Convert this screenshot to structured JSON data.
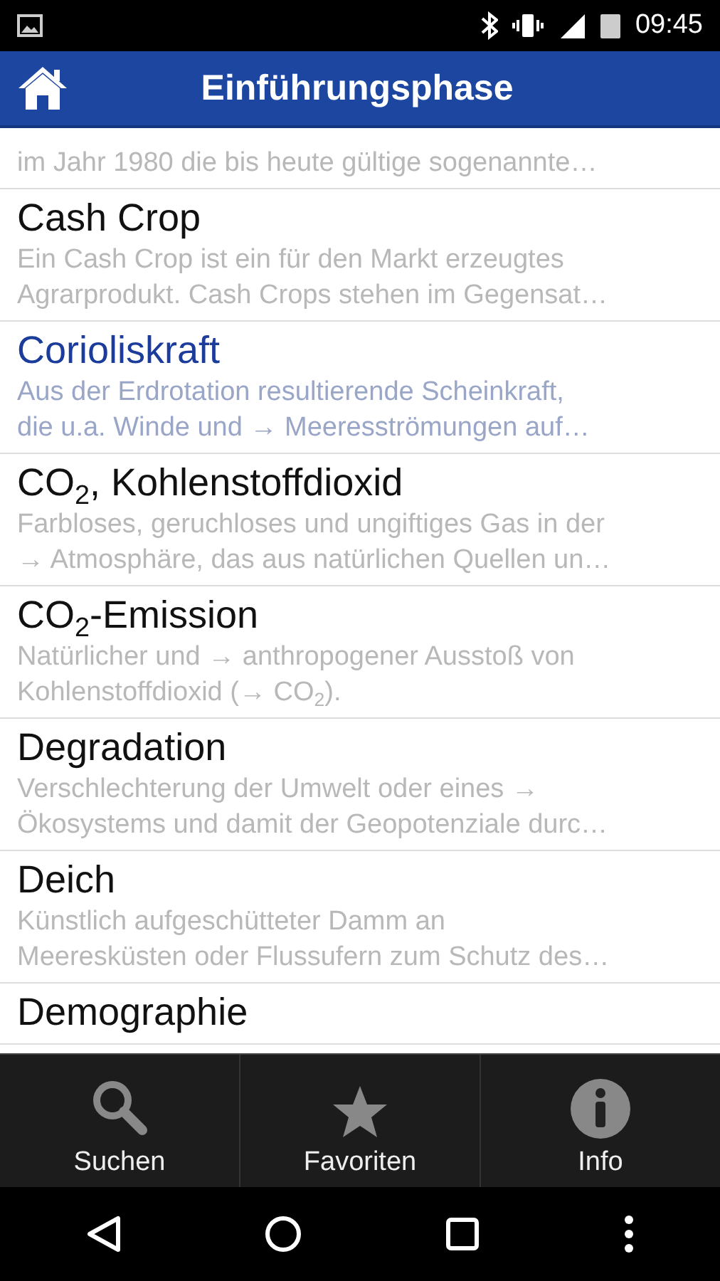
{
  "status_bar": {
    "time": "09:45"
  },
  "app_bar": {
    "title": "Einführungsphase"
  },
  "entries": [
    {
      "description": "im Jahr 1980 die bis heute gültige sogenannte…",
      "selected": false
    },
    {
      "title": "Cash Crop",
      "description": "Ein Cash Crop ist ein für den Markt erzeugtes\nAgrarprodukt. Cash Crops stehen im Gegensat…",
      "selected": false
    },
    {
      "title": "Corioliskraft",
      "description": "Aus der Erdrotation resultierende Scheinkraft,\ndie u.a. Winde und → Meeresströmungen auf…",
      "selected": true
    },
    {
      "title": "CO$_{2}$, Kohlenstoffdioxid",
      "description": "Farbloses, geruchloses und ungiftiges Gas in der\n→ Atmosphäre, das aus natürlichen Quellen un…",
      "selected": false
    },
    {
      "title": "CO$_{2}$-Emission",
      "description": "Natürlicher und → anthropogener Ausstoß von\nKohlenstoffdioxid (→ CO$_{2}$).",
      "selected": false
    },
    {
      "title": "Degradation",
      "description": "Verschlechterung der Umwelt oder eines →\nÖkosystems und damit der Geopotenziale durc…",
      "selected": false
    },
    {
      "title": "Deich",
      "description": "Künstlich aufgeschütteter Damm an\nMeeresküsten oder Flussufern zum Schutz des…",
      "selected": false
    },
    {
      "title": "Demographie",
      "selected": false
    }
  ],
  "tabs": [
    {
      "label": "Suchen",
      "kind": "search"
    },
    {
      "label": "Favoriten",
      "kind": "star"
    },
    {
      "label": "Info",
      "kind": "info"
    }
  ]
}
